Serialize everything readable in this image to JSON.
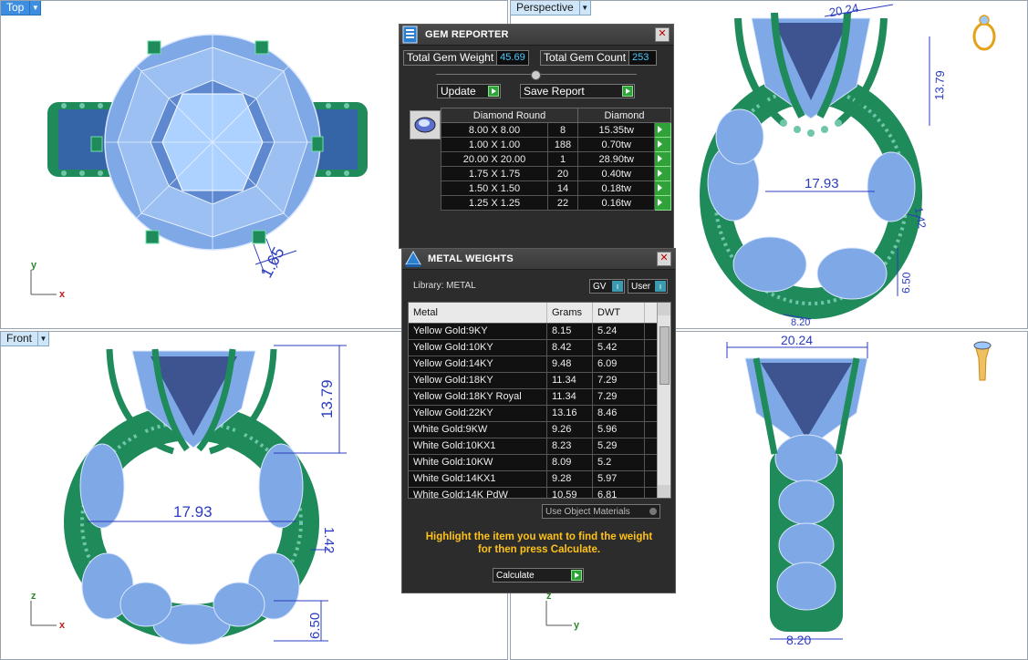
{
  "viewports": {
    "top": {
      "label": "Top",
      "axis_v": "y",
      "axis_h": "x"
    },
    "perspective": {
      "label": "Perspective"
    },
    "front": {
      "label": "Front",
      "axis_v": "z",
      "axis_h": "x"
    },
    "right": {
      "axis_v": "z",
      "axis_h": "y"
    }
  },
  "dimensions": {
    "top_prong": "1.65",
    "width": "20.24",
    "height": "13.79",
    "inner_diameter": "17.93",
    "band_small": "1.42",
    "band_depth": "6.50",
    "shank_width": "8.20"
  },
  "gem_reporter": {
    "title": "GEM REPORTER",
    "total_weight_label": "Total Gem Weight",
    "total_weight_value": "45.69",
    "total_count_label": "Total Gem Count",
    "total_count_value": "253",
    "update_label": "Update",
    "save_label": "Save Report",
    "col_shape": "Diamond Round",
    "col_material": "Diamond",
    "rows": [
      {
        "size": "8.00 X 8.00",
        "count": "8",
        "weight": "15.35tw"
      },
      {
        "size": "1.00 X 1.00",
        "count": "188",
        "weight": "0.70tw"
      },
      {
        "size": "20.00 X 20.00",
        "count": "1",
        "weight": "28.90tw"
      },
      {
        "size": "1.75 X 1.75",
        "count": "20",
        "weight": "0.40tw"
      },
      {
        "size": "1.50 X 1.50",
        "count": "14",
        "weight": "0.18tw"
      },
      {
        "size": "1.25 X 1.25",
        "count": "22",
        "weight": "0.16tw"
      }
    ]
  },
  "metal_weights": {
    "title": "METAL WEIGHTS",
    "library_label": "Library: METAL",
    "gv_label": "GV",
    "user_label": "User",
    "col_metal": "Metal",
    "col_grams": "Grams",
    "col_dwt": "DWT",
    "rows": [
      {
        "metal": "Yellow Gold:9KY",
        "grams": "8.15",
        "dwt": "5.24"
      },
      {
        "metal": "Yellow Gold:10KY",
        "grams": "8.42",
        "dwt": "5.42"
      },
      {
        "metal": "Yellow Gold:14KY",
        "grams": "9.48",
        "dwt": "6.09"
      },
      {
        "metal": "Yellow Gold:18KY",
        "grams": "11.34",
        "dwt": "7.29"
      },
      {
        "metal": "Yellow Gold:18KY Royal",
        "grams": "11.34",
        "dwt": "7.29"
      },
      {
        "metal": "Yellow Gold:22KY",
        "grams": "13.16",
        "dwt": "8.46"
      },
      {
        "metal": "White Gold:9KW",
        "grams": "9.26",
        "dwt": "5.96"
      },
      {
        "metal": "White Gold:10KX1",
        "grams": "8.23",
        "dwt": "5.29"
      },
      {
        "metal": "White Gold:10KW",
        "grams": "8.09",
        "dwt": "5.2"
      },
      {
        "metal": "White Gold:14KX1",
        "grams": "9.28",
        "dwt": "5.97"
      },
      {
        "metal": "White Gold:14K PdW",
        "grams": "10.59",
        "dwt": "6.81"
      }
    ],
    "use_object_materials": "Use Object Materials",
    "hint_line1": "Highlight the item you want to find the weight",
    "hint_line2": "for then press Calculate.",
    "calculate_label": "Calculate"
  },
  "colors": {
    "gem": "#7fa8e6",
    "metal": "#1f8a5a",
    "dimension": "#2b3cc0",
    "accent_tab": "#3d8ee0"
  }
}
